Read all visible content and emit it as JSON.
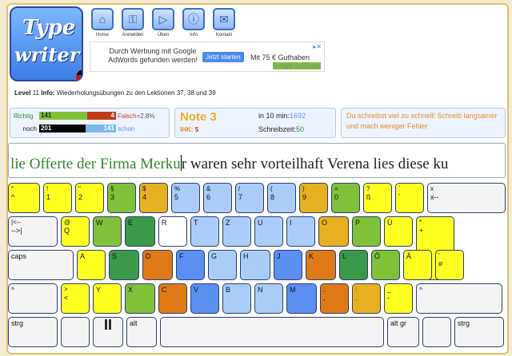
{
  "logo": {
    "line1": "Type",
    "line2": "writer"
  },
  "nav": [
    {
      "label": "Home",
      "icon": "home-icon"
    },
    {
      "label": "Anmelden",
      "icon": "login-icon"
    },
    {
      "label": "Üben",
      "icon": "play-icon"
    },
    {
      "label": "Info",
      "icon": "info-icon"
    },
    {
      "label": "Kontakt",
      "icon": "mail-icon"
    }
  ],
  "ad": {
    "text1": "Durch Werbung mit Google AdWords gefunden werden!",
    "button": "Jetzt starten",
    "text2": "Mit 75 € Guthaben",
    "brand": "Google AdWords"
  },
  "level": {
    "label": "Level",
    "value": "11",
    "info_label": "Info:",
    "info": "Wiederholungsübungen zu den Lektionen 37, 38 und 39"
  },
  "stats": {
    "richtig_label": "Richtig",
    "richtig": "141",
    "falsch_val": "4",
    "falsch_label": "Falsch",
    "falsch_pct": "=2.8%",
    "noch_label": "noch",
    "noch": "201",
    "schon": "141",
    "schon_label": "schon",
    "note_label": "Note 3",
    "ihk_label": "IHK:",
    "ihk": "5",
    "in10_label": "in 10 min:",
    "in10": "1692",
    "schreibzeit_label": "Schreibzeit:",
    "schreibzeit": "50",
    "message": "Du schreibst viel zu schnell! Schreib langsamer und mach weniger Fehler"
  },
  "text": {
    "typed": "lie Offerte der Firma Merku",
    "rest": "r waren sehr vorteilhaft Verena lies diese ku"
  },
  "colors": {
    "yellow": "#ffff20",
    "orange": "#e8b020",
    "green": "#7fc23a",
    "darkgreen": "#3a9a4a",
    "blue": "#5b8ff0",
    "lightblue": "#a9cdf7",
    "red": "#e07a18"
  },
  "keys": {
    "row1": [
      {
        "top": "°",
        "bot": "^"
      },
      {
        "top": "!",
        "bot": "1"
      },
      {
        "top": "\"",
        "bot": "2"
      },
      {
        "top": "§",
        "bot": "3"
      },
      {
        "top": "$",
        "bot": "4"
      },
      {
        "top": "%",
        "bot": "5"
      },
      {
        "top": "&",
        "bot": "6"
      },
      {
        "top": "/",
        "bot": "7"
      },
      {
        "top": "(",
        "bot": "8"
      },
      {
        "top": ")",
        "bot": "9"
      },
      {
        "top": "=",
        "bot": "0"
      },
      {
        "top": "?",
        "bot": "ß"
      },
      {
        "top": "`",
        "bot": "´"
      },
      {
        "top": "x",
        "bot": "x--"
      }
    ],
    "row2": [
      {
        "top": "|<--",
        "bot": "-->|"
      },
      {
        "top": "@",
        "bot": "Q"
      },
      {
        "top": "",
        "bot": "W"
      },
      {
        "top": "",
        "bot": "E"
      },
      {
        "top": "",
        "bot": "R"
      },
      {
        "top": "",
        "bot": "T"
      },
      {
        "top": "",
        "bot": "Z"
      },
      {
        "top": "",
        "bot": "U"
      },
      {
        "top": "",
        "bot": "I"
      },
      {
        "top": "",
        "bot": "O"
      },
      {
        "top": "",
        "bot": "P"
      },
      {
        "top": "",
        "bot": "Ü"
      },
      {
        "top": "*",
        "bot": "+"
      }
    ],
    "row3": [
      {
        "top": "",
        "bot": "caps"
      },
      {
        "top": "",
        "bot": "A"
      },
      {
        "top": "",
        "bot": "S"
      },
      {
        "top": "",
        "bot": "D"
      },
      {
        "top": "",
        "bot": "F"
      },
      {
        "top": "",
        "bot": "G"
      },
      {
        "top": "",
        "bot": "H"
      },
      {
        "top": "",
        "bot": "J"
      },
      {
        "top": "",
        "bot": "K"
      },
      {
        "top": "",
        "bot": "L"
      },
      {
        "top": "",
        "bot": "Ö"
      },
      {
        "top": "",
        "bot": "Ä"
      },
      {
        "top": "'",
        "bot": "#"
      }
    ],
    "row4": [
      {
        "top": "",
        "bot": "^"
      },
      {
        "top": ">",
        "bot": "<"
      },
      {
        "top": "",
        "bot": "Y"
      },
      {
        "top": "",
        "bot": "X"
      },
      {
        "top": "",
        "bot": "C"
      },
      {
        "top": "",
        "bot": "V"
      },
      {
        "top": "",
        "bot": "B"
      },
      {
        "top": "",
        "bot": "N"
      },
      {
        "top": "",
        "bot": "M"
      },
      {
        "top": ";",
        "bot": ","
      },
      {
        "top": ":",
        "bot": "."
      },
      {
        "top": "_",
        "bot": "-"
      },
      {
        "top": "",
        "bot": "^"
      }
    ],
    "row5": [
      {
        "top": "",
        "bot": "strg"
      },
      {
        "top": "",
        "bot": ""
      },
      {
        "top": "",
        "bot": "II"
      },
      {
        "top": "",
        "bot": "alt"
      },
      {
        "top": "",
        "bot": ""
      },
      {
        "top": "",
        "bot": "alt gr"
      },
      {
        "top": "",
        "bot": ""
      },
      {
        "top": "",
        "bot": "strg"
      }
    ]
  }
}
